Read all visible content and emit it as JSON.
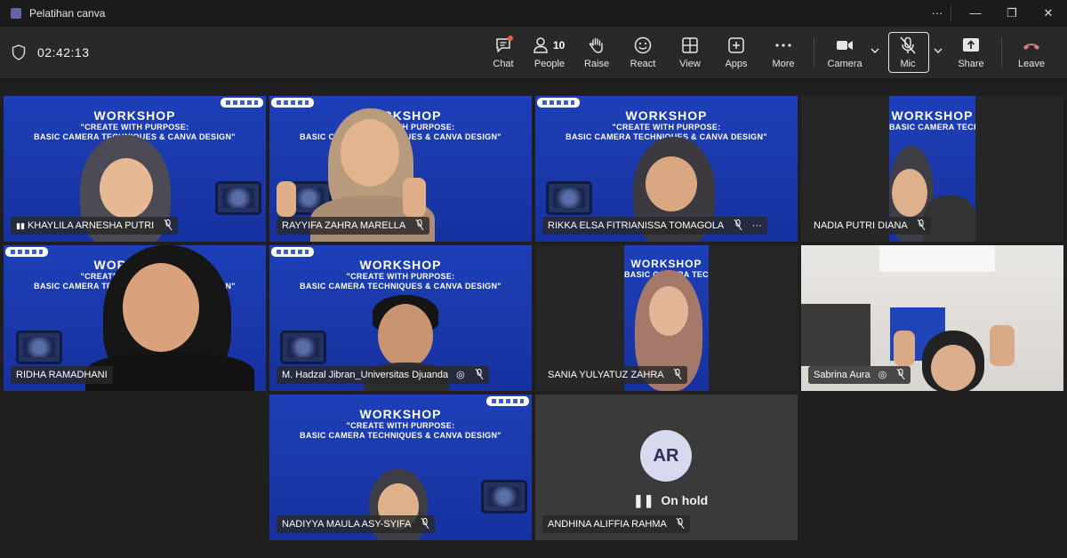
{
  "window": {
    "title": "Pelatihan canva",
    "controls": [
      "···",
      "—",
      "❐",
      "✕"
    ]
  },
  "toolbar": {
    "timer": "02:42:13",
    "buttons": [
      {
        "id": "chat",
        "label": "Chat"
      },
      {
        "id": "people",
        "label": "People",
        "count": "10"
      },
      {
        "id": "raise",
        "label": "Raise"
      },
      {
        "id": "react",
        "label": "React"
      },
      {
        "id": "view",
        "label": "View"
      },
      {
        "id": "apps",
        "label": "Apps"
      },
      {
        "id": "more",
        "label": "More"
      },
      {
        "id": "camera",
        "label": "Camera"
      },
      {
        "id": "mic",
        "label": "Mic"
      },
      {
        "id": "share",
        "label": "Share"
      },
      {
        "id": "leave",
        "label": "Leave"
      }
    ]
  },
  "banner": {
    "headline": "WORKSHOP",
    "line1": "\"CREATE WITH PURPOSE:",
    "line2": "BASIC CAMERA TECHNIQUES & CANVA DESIGN\""
  },
  "participants": [
    {
      "name": "KHAYLILA ARNESHA PUTRI",
      "muted": true,
      "signal": true
    },
    {
      "name": "RAYYIFA ZAHRA MARELLA",
      "muted": true
    },
    {
      "name": "RIKKA ELSA FITRIANISSA TOMAGOLA",
      "muted": true,
      "more": "···"
    },
    {
      "name": "NADIA PUTRI DIANA",
      "muted": true
    },
    {
      "name": "RIDHA RAMADHANI",
      "muted": false
    },
    {
      "name": "M. Hadzal Jibran_Universitas Djuanda",
      "muted": true,
      "shared_icon": true
    },
    {
      "name": "SANIA YULYATUZ ZAHRA",
      "muted": true
    },
    {
      "name": "Sabrina Aura",
      "muted": true,
      "shared_icon": true
    },
    {
      "name": "NADIYYA MAULA ASY-SYIFA",
      "muted": true
    },
    {
      "name": "ANDHINA ALIFFIA RAHMA",
      "muted": true,
      "initials": "AR",
      "status": "On hold"
    }
  ],
  "colors": {
    "accent": "#6264a7",
    "leave": "#e37d80",
    "banner_blue": "#1d3fb8",
    "hold_bg": "#3a3a3a"
  }
}
